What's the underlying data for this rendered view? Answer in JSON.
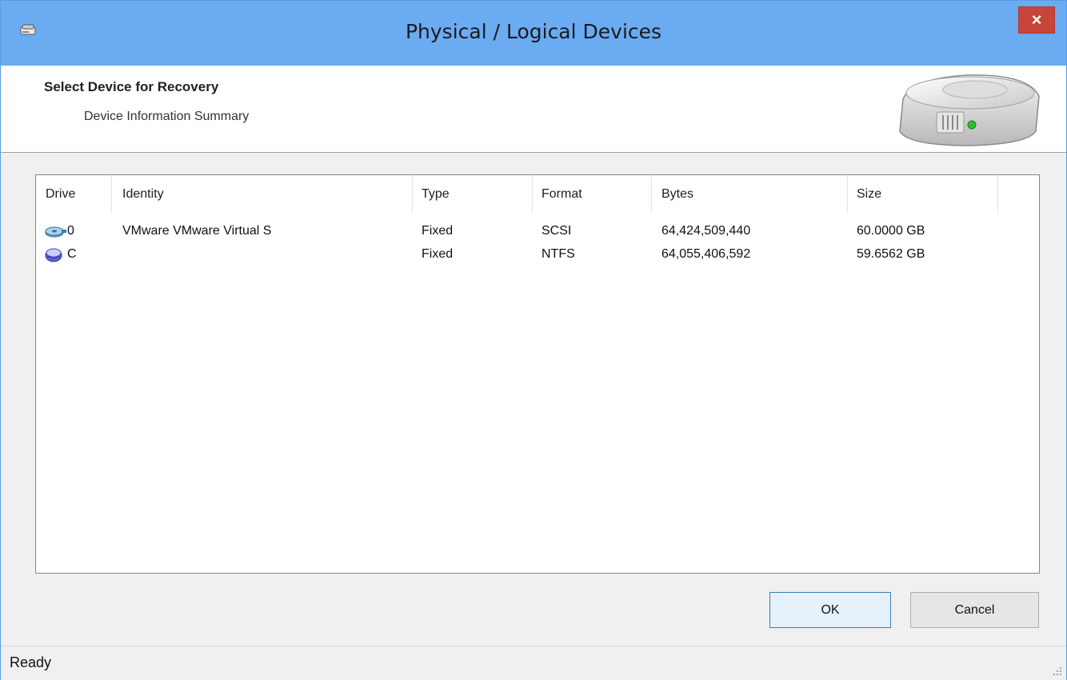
{
  "window": {
    "title": "Physical / Logical Devices",
    "close_label": "×"
  },
  "header": {
    "title": "Select Device for Recovery",
    "subtitle": "Device Information Summary"
  },
  "table": {
    "columns": [
      "Drive",
      "Identity",
      "Type",
      "Format",
      "Bytes",
      "Size"
    ],
    "rows": [
      {
        "drive": "0",
        "drive_icon": "physical-disk-icon",
        "identity": "VMware  VMware Virtual S",
        "type": "Fixed",
        "format": "SCSI",
        "bytes": "64,424,509,440",
        "size": "60.0000 GB"
      },
      {
        "drive": "C",
        "drive_icon": "logical-volume-icon",
        "identity": "",
        "type": "Fixed",
        "format": "NTFS",
        "bytes": "64,055,406,592",
        "size": "59.6562 GB"
      }
    ]
  },
  "buttons": {
    "ok": "OK",
    "cancel": "Cancel"
  },
  "status": {
    "text": "Ready"
  },
  "colors": {
    "titlebar": "#6aabf2",
    "close_button": "#c7463a"
  }
}
